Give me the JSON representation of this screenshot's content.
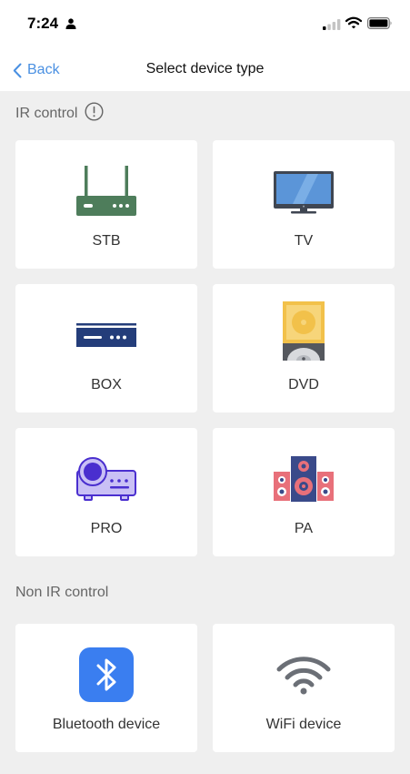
{
  "status": {
    "time": "7:24"
  },
  "nav": {
    "back_label": "Back",
    "title": "Select device type"
  },
  "sections": {
    "ir": {
      "title": "IR control"
    },
    "non_ir": {
      "title": "Non IR control"
    }
  },
  "devices": {
    "stb": {
      "label": "STB",
      "icon": "set-top-box-icon"
    },
    "tv": {
      "label": "TV",
      "icon": "tv-icon"
    },
    "box": {
      "label": "BOX",
      "icon": "media-box-icon"
    },
    "dvd": {
      "label": "DVD",
      "icon": "dvd-icon"
    },
    "pro": {
      "label": "PRO",
      "icon": "projector-icon"
    },
    "pa": {
      "label": "PA",
      "icon": "speaker-icon"
    },
    "bluetooth": {
      "label": "Bluetooth device",
      "icon": "bluetooth-icon"
    },
    "wifi": {
      "label": "WiFi device",
      "icon": "wifi-icon"
    }
  },
  "colors": {
    "accent": "#4a90e2",
    "background": "#efefef",
    "card": "#ffffff",
    "stb": "#4e7d5b",
    "bluetooth": "#3a7ef0"
  }
}
